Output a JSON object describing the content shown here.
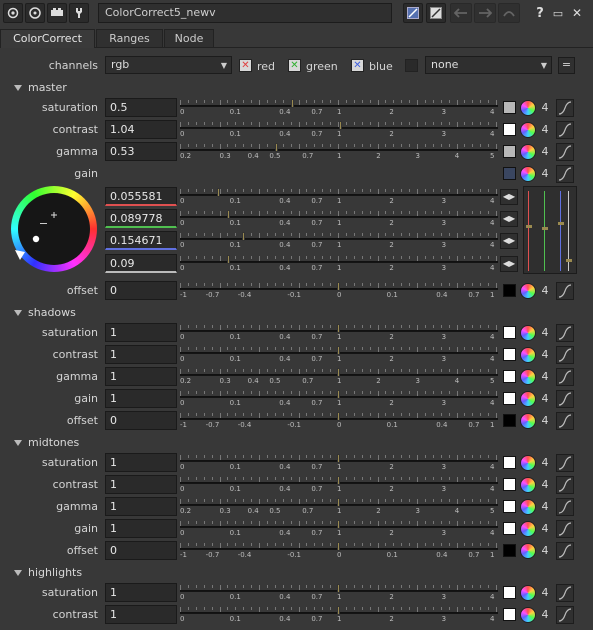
{
  "node_name": "ColorCorrect5_newv",
  "toolbar": {
    "help": "?",
    "minimize": "▭",
    "close": "✕"
  },
  "tabs": [
    {
      "label": "ColorCorrect"
    },
    {
      "label": "Ranges"
    },
    {
      "label": "Node"
    }
  ],
  "channels": {
    "label": "channels",
    "value": "rgb",
    "red": "red",
    "green": "green",
    "blue": "blue",
    "mask_value": "none",
    "eq_button": "="
  },
  "scales": {
    "sat": [
      "0",
      "0.1",
      "0.4",
      "0.7",
      "1",
      "2",
      "3",
      "4"
    ],
    "gamma": [
      "0.2",
      "0.3",
      "0.4",
      "0.5",
      "0.7",
      "1",
      "2",
      "3",
      "4",
      "5"
    ],
    "offset": [
      "-1",
      "-0.7",
      "-0.4",
      "-0.1",
      "0",
      "0.1",
      "0.4",
      "0.7",
      "1"
    ]
  },
  "four_label": "4",
  "sections": [
    {
      "title": "master",
      "rows": [
        {
          "label": "saturation",
          "value": "0.5",
          "scale": "sat",
          "handle": 0.5,
          "swatch": "#b8b8b8"
        },
        {
          "label": "contrast",
          "value": "1.04",
          "scale": "sat",
          "handle": 1.04,
          "swatch": "#ffffff"
        },
        {
          "label": "gamma",
          "value": "0.53",
          "scale": "gamma",
          "handle": 0.53,
          "swatch": "#b8b8b8"
        }
      ],
      "gain": {
        "label": "gain",
        "values": [
          "0.055581",
          "0.089778",
          "0.154671",
          "0.09"
        ],
        "handles": [
          0.055581,
          0.089778,
          0.154671,
          0.09
        ],
        "swatch": "#3a4660"
      },
      "offset": {
        "label": "offset",
        "value": "0",
        "handle": 0,
        "swatch": "#000000"
      }
    },
    {
      "title": "shadows",
      "rows": [
        {
          "label": "saturation",
          "value": "1",
          "scale": "sat",
          "handle": 1,
          "swatch": "#ffffff"
        },
        {
          "label": "contrast",
          "value": "1",
          "scale": "sat",
          "handle": 1,
          "swatch": "#ffffff"
        },
        {
          "label": "gamma",
          "value": "1",
          "scale": "gamma",
          "handle": 1,
          "swatch": "#ffffff"
        },
        {
          "label": "gain",
          "value": "1",
          "scale": "sat",
          "handle": 1,
          "swatch": "#ffffff"
        },
        {
          "label": "offset",
          "value": "0",
          "scale": "offset",
          "handle": 0,
          "swatch": "#000000"
        }
      ]
    },
    {
      "title": "midtones",
      "rows": [
        {
          "label": "saturation",
          "value": "1",
          "scale": "sat",
          "handle": 1,
          "swatch": "#ffffff"
        },
        {
          "label": "contrast",
          "value": "1",
          "scale": "sat",
          "handle": 1,
          "swatch": "#ffffff"
        },
        {
          "label": "gamma",
          "value": "1",
          "scale": "gamma",
          "handle": 1,
          "swatch": "#ffffff"
        },
        {
          "label": "gain",
          "value": "1",
          "scale": "sat",
          "handle": 1,
          "swatch": "#ffffff"
        },
        {
          "label": "offset",
          "value": "0",
          "scale": "offset",
          "handle": 0,
          "swatch": "#000000"
        }
      ]
    },
    {
      "title": "highlights",
      "rows": [
        {
          "label": "saturation",
          "value": "1",
          "scale": "sat",
          "handle": 1,
          "swatch": "#ffffff"
        },
        {
          "label": "contrast",
          "value": "1",
          "scale": "sat",
          "handle": 1,
          "swatch": "#ffffff"
        }
      ]
    }
  ],
  "colors": {
    "panel": "#383838",
    "field": "#2a2a2a",
    "handle": "#9a8a50",
    "red": "#e05050",
    "green": "#50c050",
    "blue": "#6070e0"
  }
}
